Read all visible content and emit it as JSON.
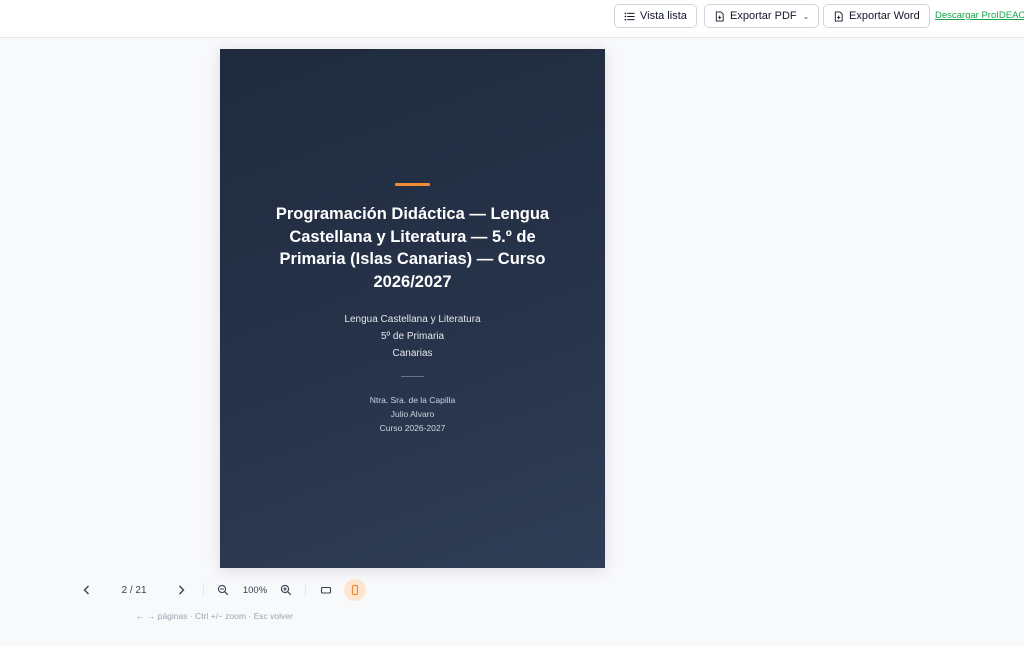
{
  "toolbar": {
    "list_view_label": "Vista lista",
    "export_pdf_label": "Exportar PDF",
    "export_word_label": "Exportar Word",
    "download_link": "Descargar ProIDEAC"
  },
  "cover": {
    "title": "Programación Didáctica — Lengua Castellana y Literatura — 5.º de Primaria (Islas Canarias) — Curso 2026/2027",
    "subject": "Lengua Castellana y Literatura",
    "grade": "5º de Primaria",
    "region": "Canarias",
    "school": "Ntra. Sra. de la Capilla",
    "author": "Julio Alvaro",
    "course": "Curso 2026-2027"
  },
  "viewer": {
    "page_indicator": "2 / 21",
    "zoom_level": "100%",
    "hint": "← → páginas · Ctrl +/− zoom · Esc volver"
  },
  "colors": {
    "accent": "#f28c38",
    "cover_bg": "#27334a",
    "link": "#16a34a"
  }
}
